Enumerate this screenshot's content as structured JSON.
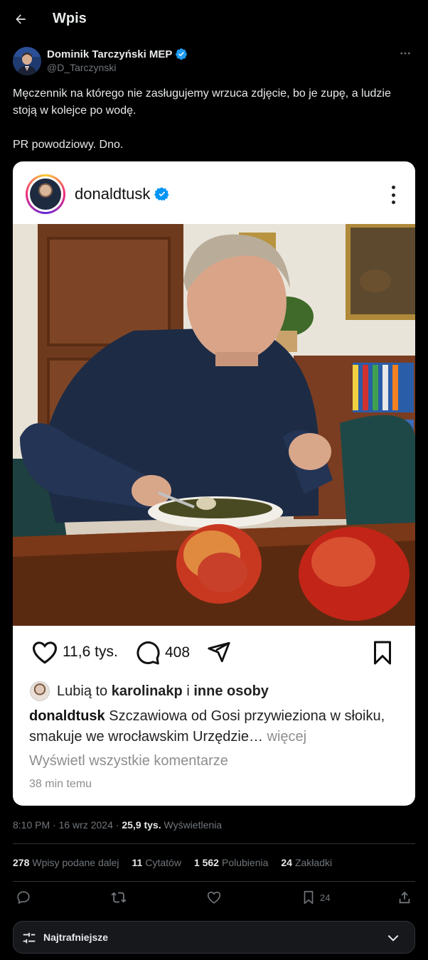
{
  "header": {
    "title": "Wpis",
    "back_icon": "arrow-left-icon"
  },
  "author": {
    "name": "Dominik Tarczyński MEP",
    "handle": "@D_Tarczynski",
    "verified": true
  },
  "tweet": {
    "paragraphs": [
      "Męczennik na którego nie zasługujemy wrzuca zdjęcie, bo je zupę, a ludzie stoją w kolejce po wodę.",
      "PR powodziowy. Dno."
    ]
  },
  "instagram": {
    "username": "donaldtusk",
    "likes": "11,6 tys.",
    "comments": "408",
    "liked_by_prefix": "Lubią to",
    "liked_by_user": "karolinakp",
    "liked_by_joiner": "i",
    "liked_by_others": "inne osoby",
    "caption_user": "donaldtusk",
    "caption_text": "Szczawiowa od Gosi przywieziona w słoiku, smakuje we wrocławskim Urzędzie…",
    "caption_more": "więcej",
    "view_comments": "Wyświetl wszystkie komentarze",
    "time_ago": "38 min temu"
  },
  "meta": {
    "time": "8:10 PM",
    "separator": "·",
    "date": "16 wrz 2024",
    "views": "25,9 tys.",
    "views_label": "Wyświetlenia"
  },
  "stats": {
    "reposts": "278",
    "reposts_label": "Wpisy podane dalej",
    "quotes": "11",
    "quotes_label": "Cytatów",
    "likes": "1 562",
    "likes_label": "Polubienia",
    "bookmarks": "24",
    "bookmarks_label": "Zakładki"
  },
  "actions": {
    "bookmark_count": "24"
  },
  "sort": {
    "label": "Najtrafniejsze"
  },
  "colors": {
    "accent": "#1d9bf0",
    "background": "#000000",
    "muted": "#71767b"
  }
}
